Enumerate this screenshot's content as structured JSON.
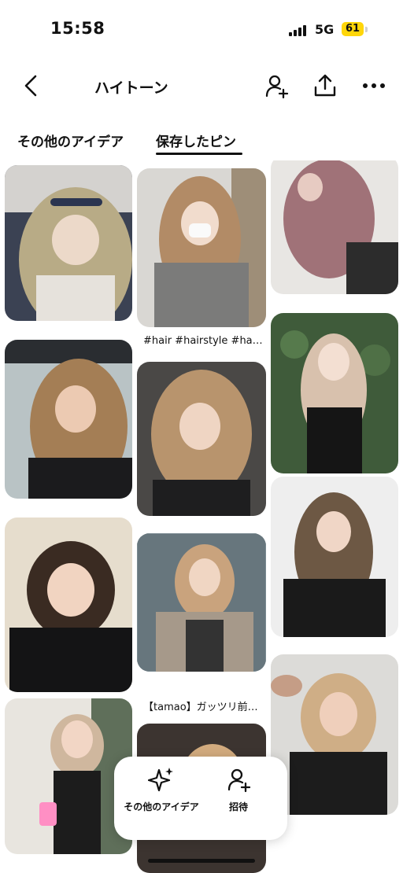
{
  "status_bar": {
    "time": "15:58",
    "network": "5G",
    "battery": "61"
  },
  "header": {
    "title": "ハイトーン",
    "icons": [
      "back-arrow-icon",
      "add-collaborator-icon",
      "share-icon",
      "more-icon"
    ]
  },
  "tabs": [
    {
      "label": "その他のアイデア",
      "selected": false
    },
    {
      "label": "保存したピン",
      "selected": true
    }
  ],
  "pins": {
    "captions": [
      "#hair #hairstyle #ha…",
      "【tamao】ガッツリ前…"
    ]
  },
  "action_bar": {
    "more_ideas_label": "その他のアイデア",
    "invite_label": "招待"
  },
  "colors": {
    "accent": "#111111",
    "battery": "#ffd60a"
  }
}
